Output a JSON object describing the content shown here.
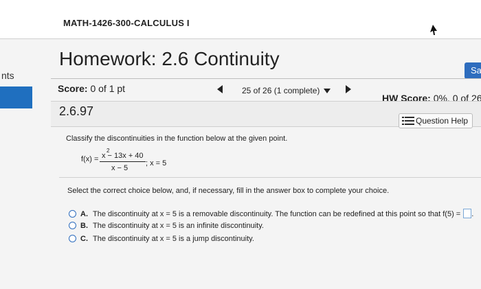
{
  "header": {
    "course_title": "MATH-1426-300-CALCULUS I"
  },
  "sidebar": {
    "label": "nts"
  },
  "homework": {
    "title": "Homework: 2.6 Continuity",
    "save_label": "Sa",
    "score_label": "Score:",
    "score_value": "0 of 1 pt",
    "nav_label": "25 of 26 (1 complete)",
    "hw_score_label": "HW Score:",
    "hw_score_value": "0%, 0 of 26"
  },
  "question": {
    "number": "2.6.97",
    "help_label": "Question Help",
    "prompt": "Classify the discontinuities in the function below at the given point.",
    "fx_label": "f(x) =",
    "numerator": "x  − 13x + 40",
    "numerator_exponent": "2",
    "denominator": "x − 5",
    "point": "; x = 5",
    "instruction": "Select the correct choice below, and, if necessary, fill in the answer box to complete your choice.",
    "choices": [
      {
        "letter": "A.",
        "text": "The discontinuity at x = 5 is a removable discontinuity. The function can be redefined at this point so that f(5) =",
        "suffix": "."
      },
      {
        "letter": "B.",
        "text": "The discontinuity at x = 5 is an infinite discontinuity."
      },
      {
        "letter": "C.",
        "text": "The discontinuity at x = 5 is a jump discontinuity."
      }
    ]
  },
  "icons": {
    "cursor": "mouse-cursor-icon",
    "help": "list-icon",
    "prev": "triangle-left-icon",
    "next": "triangle-right-icon",
    "dropdown": "triangle-down-icon"
  },
  "colors": {
    "accent": "#2e6dbe",
    "sidebar": "#1f6fbf"
  }
}
